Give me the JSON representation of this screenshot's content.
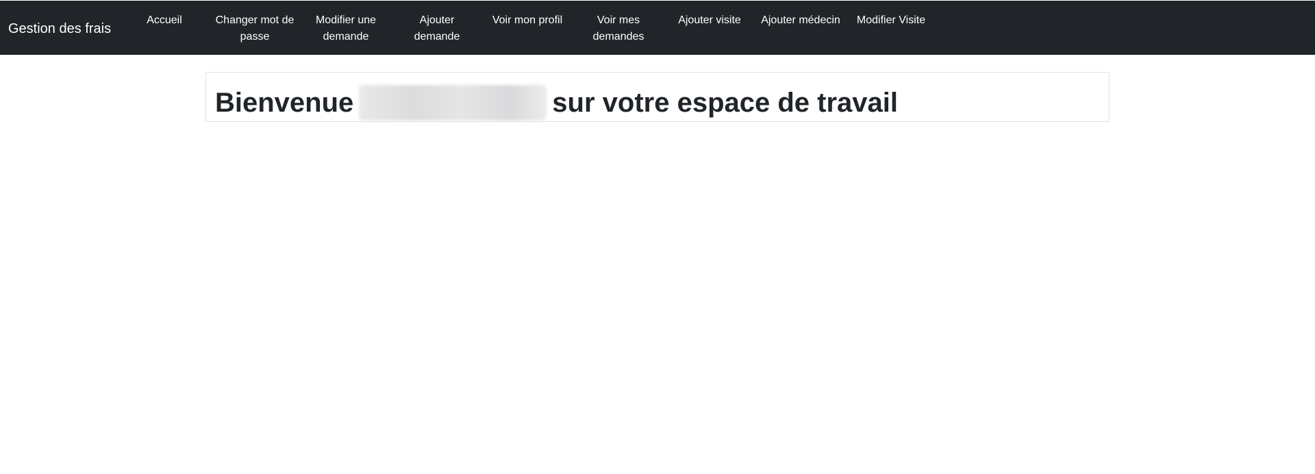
{
  "navbar": {
    "brand": "Gestion des frais",
    "items": [
      {
        "label": "Accueil"
      },
      {
        "label": "Changer mot de passe"
      },
      {
        "label": "Modifier une demande"
      },
      {
        "label": "Ajouter demande"
      },
      {
        "label": "Voir mon profil"
      },
      {
        "label": "Voir mes demandes"
      },
      {
        "label": "Ajouter visite"
      },
      {
        "label": "Ajouter médecin"
      },
      {
        "label": "Modifier Visite"
      }
    ]
  },
  "main": {
    "welcome_prefix": "Bienvenue",
    "welcome_suffix": "sur votre espace de travail"
  },
  "colors": {
    "navbar_bg": "#212529",
    "navbar_text": "#ffffff",
    "heading_text": "#212529",
    "box_border": "#dee2e6"
  }
}
